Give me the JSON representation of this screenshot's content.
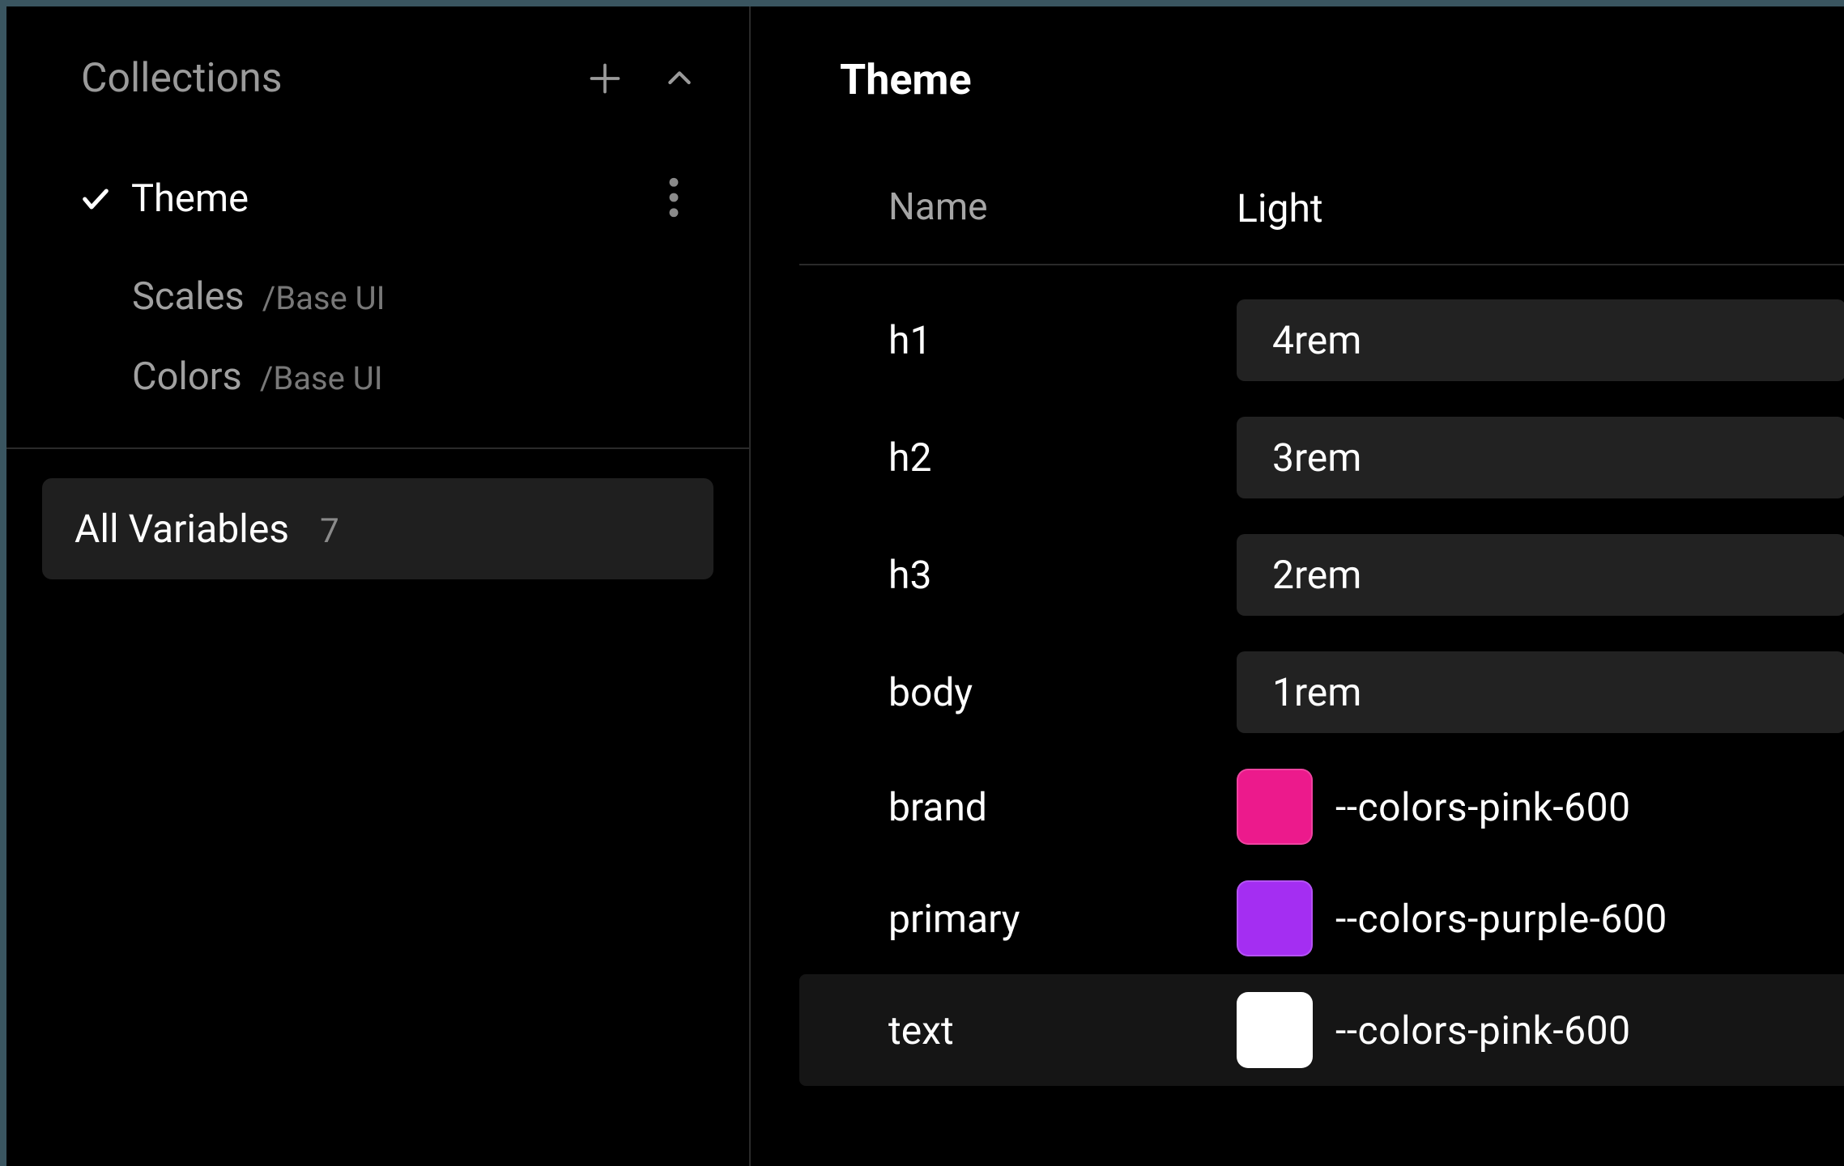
{
  "sidebar": {
    "header_label": "Collections",
    "collections": [
      {
        "name": "Theme",
        "source": "",
        "selected": true
      },
      {
        "name": "Scales",
        "source": "/Base UI",
        "selected": false
      },
      {
        "name": "Colors",
        "source": "/Base UI",
        "selected": false
      }
    ],
    "all_variables_label": "All Variables",
    "all_variables_count": "7"
  },
  "main": {
    "title": "Theme",
    "columns": {
      "name": "Name",
      "mode": "Light"
    },
    "rows": [
      {
        "name": "h1",
        "kind": "text",
        "value": "4rem"
      },
      {
        "name": "h2",
        "kind": "text",
        "value": "3rem"
      },
      {
        "name": "h3",
        "kind": "text",
        "value": "2rem"
      },
      {
        "name": "body",
        "kind": "text",
        "value": "1rem"
      },
      {
        "name": "brand",
        "kind": "color",
        "ref": "--colors-pink-600",
        "swatch": "#ec1a8c"
      },
      {
        "name": "primary",
        "kind": "color",
        "ref": "--colors-purple-600",
        "swatch": "#a42ef2"
      },
      {
        "name": "text",
        "kind": "color",
        "ref": "--colors-pink-600",
        "swatch": "#ffffff",
        "highlight": true
      }
    ]
  }
}
